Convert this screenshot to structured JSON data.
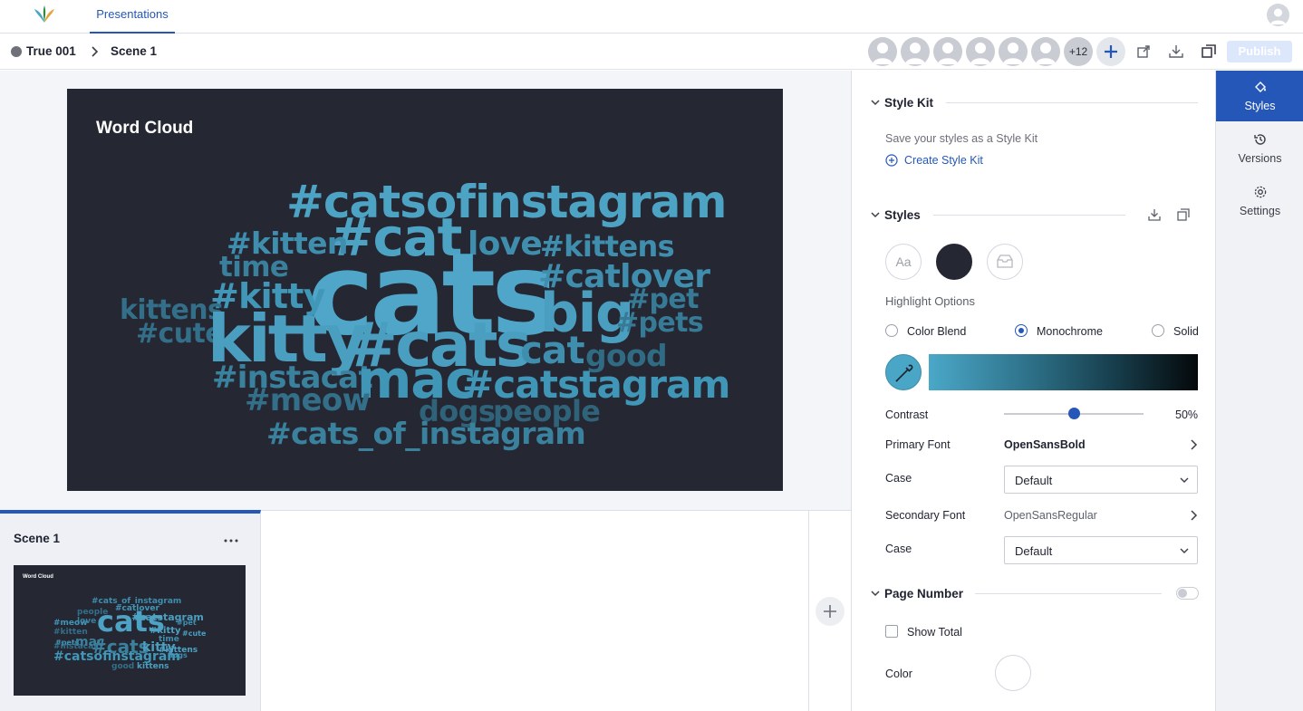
{
  "app": {
    "tab": "Presentations"
  },
  "breadcrumb": {
    "title": "True 001",
    "scene": "Scene 1"
  },
  "toolbar": {
    "extra_collaborators": "+12",
    "publish_label": "Publish"
  },
  "slide": {
    "title": "Word Cloud",
    "words": [
      {
        "text": "#catsofinstagram",
        "color": "#4da3c4"
      },
      {
        "text": "#cat",
        "color": "#4da3c4"
      },
      {
        "text": "#kitten",
        "color": "#3f8eae"
      },
      {
        "text": "love",
        "color": "#3f8eae"
      },
      {
        "text": "#kittens",
        "color": "#3f8eae"
      },
      {
        "text": "time",
        "color": "#3a7f9c"
      },
      {
        "text": "cats",
        "color": "#4fa6c8"
      },
      {
        "text": "#catlover",
        "color": "#3f8eae"
      },
      {
        "text": "#kitty",
        "color": "#4097b8"
      },
      {
        "text": "#pet",
        "color": "#367a96"
      },
      {
        "text": "kittens",
        "color": "#336f89"
      },
      {
        "text": "big",
        "color": "#4a9fc0"
      },
      {
        "text": "#pets",
        "color": "#367a96"
      },
      {
        "text": "#cute",
        "color": "#336f89"
      },
      {
        "text": "kitty",
        "color": "#4a9fc0"
      },
      {
        "text": "#cats",
        "color": "#4a9fc0"
      },
      {
        "text": "cat",
        "color": "#3f8eae"
      },
      {
        "text": "good",
        "color": "#316a83"
      },
      {
        "text": "#instacat",
        "color": "#3a819e"
      },
      {
        "text": "mac",
        "color": "#4096b7"
      },
      {
        "text": "#catstagram",
        "color": "#4096b7"
      },
      {
        "text": "#meow",
        "color": "#336f89"
      },
      {
        "text": "dogs",
        "color": "#2f6379"
      },
      {
        "text": "people",
        "color": "#2f6379"
      },
      {
        "text": "#cats_of_instagram",
        "color": "#3a819e"
      }
    ]
  },
  "scene_card": {
    "label": "Scene 1",
    "thumb_title": "Word Cloud",
    "thumb_words": [
      "#cats_of_instagram",
      "#catlover",
      "people",
      "#catstagram",
      "cats",
      "love",
      "#pet",
      "#meow",
      "#kitten",
      "#cute",
      "#kitty",
      "#cats",
      "time",
      "#pets",
      "#instacat",
      "kitty",
      "#kittens",
      "mac",
      "dogs",
      "#catsofinstagram",
      "good",
      "kittens"
    ]
  },
  "panel": {
    "style_kit": {
      "heading": "Style Kit",
      "hint": "Save your styles as a Style Kit",
      "create_label": "Create Style Kit"
    },
    "styles": {
      "heading": "Styles",
      "text_style_label": "Aa",
      "highlight_heading": "Highlight Options",
      "options": [
        "Color Blend",
        "Monochrome",
        "Solid"
      ],
      "selected_option": "Monochrome",
      "highlight_color": "#4aa6c6",
      "contrast_label": "Contrast",
      "contrast_value": "50%",
      "contrast_fraction": 0.5,
      "primary_font_label": "Primary Font",
      "primary_font_value": "OpenSansBold",
      "case_label": "Case",
      "case_value": "Default",
      "secondary_font_label": "Secondary Font",
      "secondary_font_value": "OpenSansRegular",
      "case2_label": "Case",
      "case2_value": "Default"
    },
    "page_number": {
      "heading": "Page Number",
      "show_total_label": "Show Total",
      "color_label": "Color"
    }
  },
  "rail": {
    "items": [
      {
        "label": "Styles",
        "icon": "paint-bucket-icon",
        "active": true
      },
      {
        "label": "Versions",
        "icon": "history-icon",
        "active": false
      },
      {
        "label": "Settings",
        "icon": "gear-icon",
        "active": false
      }
    ]
  }
}
